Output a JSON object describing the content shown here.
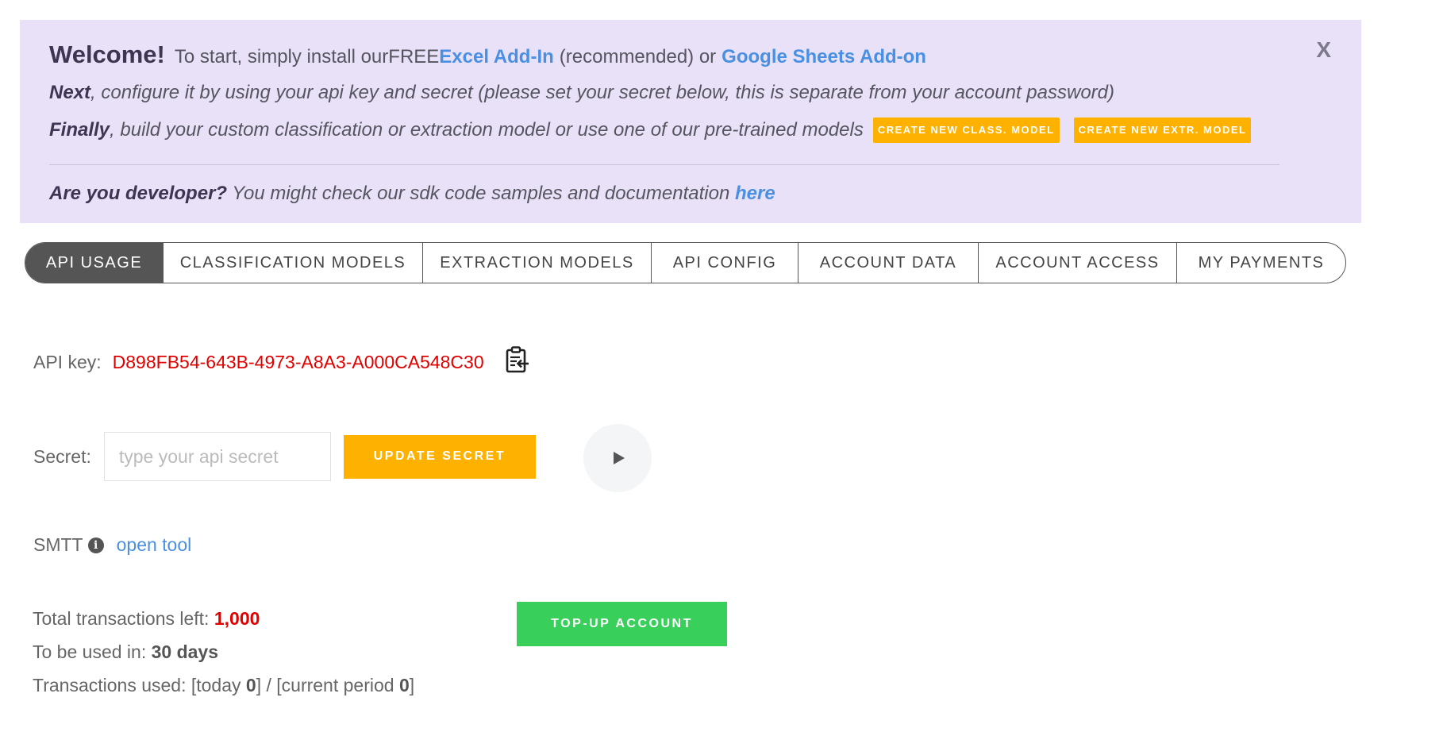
{
  "banner": {
    "close_label": "X",
    "title": "Welcome!",
    "line1_prefix": "To start, simply install our",
    "free": "FREE",
    "excel_link": "Excel Add-In",
    "line1_mid": "(recommended) or",
    "sheets_link": "Google Sheets Add-on",
    "line2_bold": "Next",
    "line2_rest": ", configure it by using your api key and secret (please set your secret below, this is separate from your account password)",
    "line3_bold": "Finally",
    "line3_rest": ", build your custom classification or extraction model or use one of our pre-trained models",
    "btn_class_model": "CREATE NEW CLASS. MODEL",
    "btn_extr_model": "CREATE NEW EXTR. MODEL",
    "line4_bold": "Are you developer?",
    "line4_rest": " You might check our sdk code samples and documentation ",
    "line4_link": "here"
  },
  "tabs": [
    {
      "label": "API USAGE",
      "active": true
    },
    {
      "label": "CLASSIFICATION MODELS",
      "active": false
    },
    {
      "label": "EXTRACTION MODELS",
      "active": false
    },
    {
      "label": "API CONFIG",
      "active": false
    },
    {
      "label": "ACCOUNT DATA",
      "active": false
    },
    {
      "label": "ACCOUNT ACCESS",
      "active": false
    },
    {
      "label": "MY PAYMENTS",
      "active": false
    }
  ],
  "api": {
    "label": "API key:",
    "key": "D898FB54-643B-4973-A8A3-A000CA548C30",
    "copy_icon": "clipboard-copy-icon"
  },
  "secret": {
    "label": "Secret:",
    "placeholder": "type your api secret",
    "value": "",
    "update_button": "UPDATE SECRET",
    "play_icon": "play-icon"
  },
  "smtt": {
    "label": "SMTT",
    "info_icon": "i",
    "link": "open tool"
  },
  "stats": {
    "total_label": "Total transactions left: ",
    "total_value": "1,000",
    "used_in_label": "To be used in: ",
    "used_in_value": "30 days",
    "used_label": "Transactions used: [today ",
    "today_value": "0",
    "mid": "] / [current period ",
    "period_value": "0",
    "end": "]"
  },
  "topup_button": "TOP-UP ACCOUNT",
  "colors": {
    "banner_bg": "#e9e1f7",
    "accent_orange": "#ffb100",
    "accent_green": "#38d05a",
    "link_blue": "#4a90e2",
    "key_red": "#e00000"
  }
}
